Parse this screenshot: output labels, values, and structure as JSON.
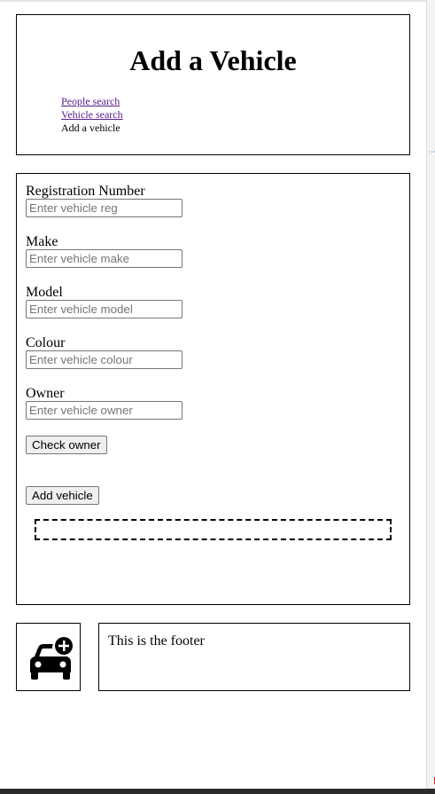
{
  "header": {
    "title": "Add a Vehicle",
    "nav": [
      {
        "label": "People search"
      },
      {
        "label": "Vehicle search"
      },
      {
        "label": "Add a vehicle"
      }
    ]
  },
  "form": {
    "fields": [
      {
        "label": "Registration Number",
        "placeholder": "Enter vehicle reg",
        "value": ""
      },
      {
        "label": "Make",
        "placeholder": "Enter vehicle make",
        "value": ""
      },
      {
        "label": "Model",
        "placeholder": "Enter vehicle model",
        "value": ""
      },
      {
        "label": "Colour",
        "placeholder": "Enter vehicle colour",
        "value": ""
      },
      {
        "label": "Owner",
        "placeholder": "Enter vehicle owner",
        "value": ""
      }
    ],
    "check_owner_label": "Check owner",
    "add_vehicle_label": "Add vehicle",
    "message": ""
  },
  "footer": {
    "logo_icon": "car-plus-icon",
    "text": "This is the footer"
  },
  "colors": {
    "visited_link": "#551a8b",
    "border": "#000000"
  }
}
